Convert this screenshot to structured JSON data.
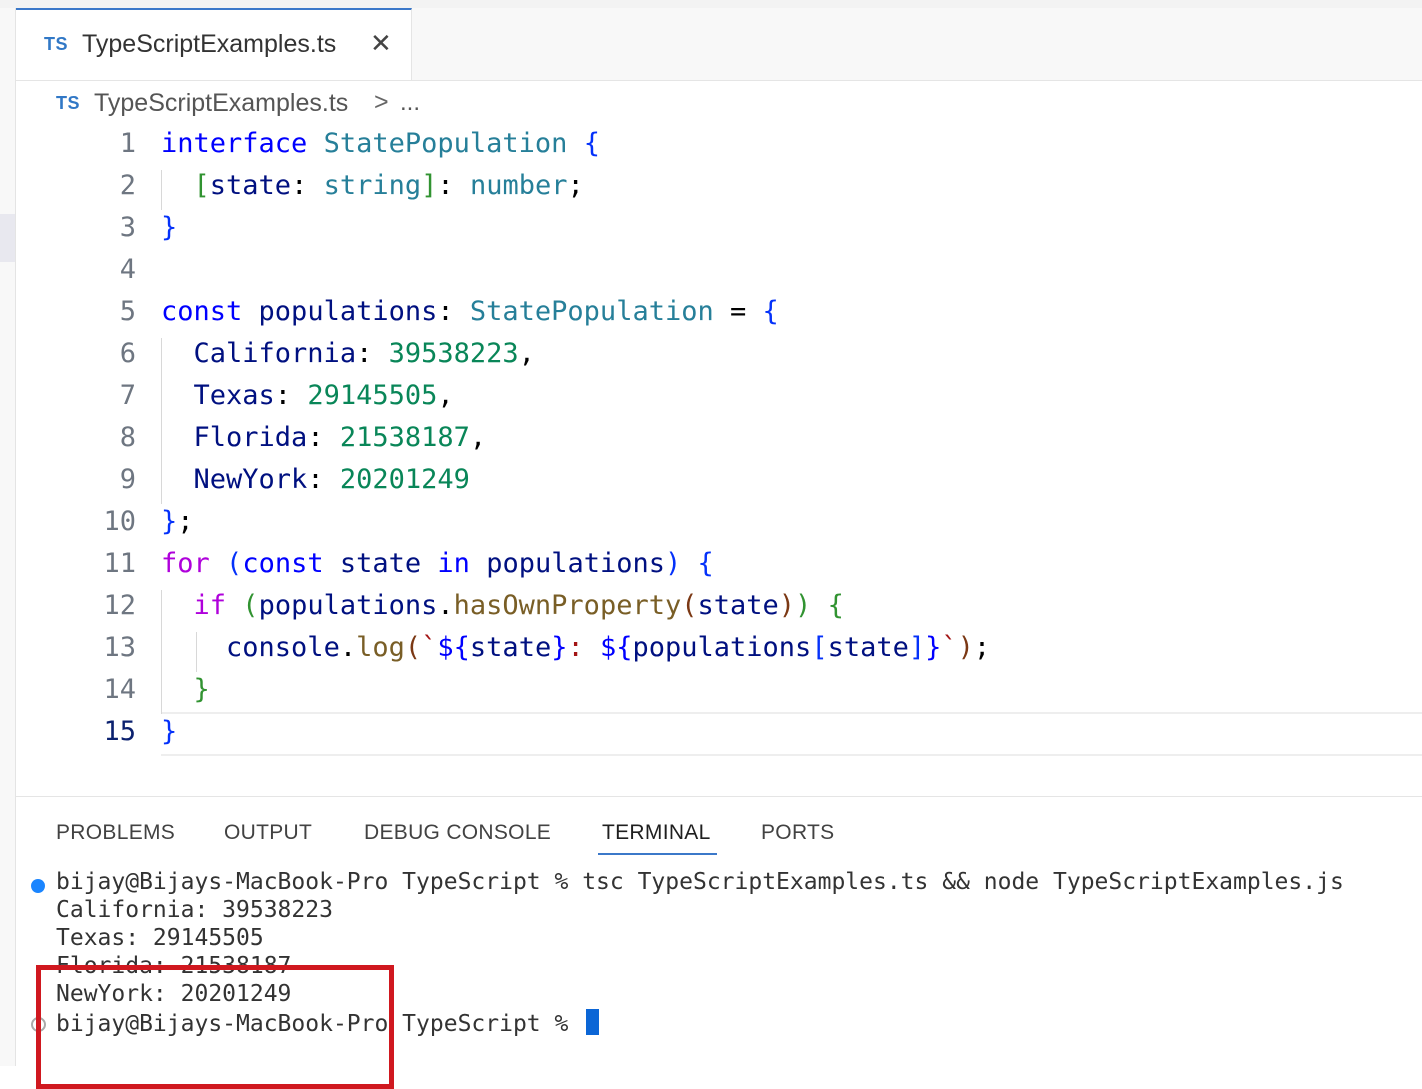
{
  "tab": {
    "badge": "TS",
    "title": "TypeScriptExamples.ts",
    "close": "✕"
  },
  "breadcrumb": {
    "badge": "TS",
    "file": "TypeScriptExamples.ts",
    "separator": ">",
    "more": "..."
  },
  "editor": {
    "lines": [
      {
        "n": "1"
      },
      {
        "n": "2"
      },
      {
        "n": "3"
      },
      {
        "n": "4"
      },
      {
        "n": "5"
      },
      {
        "n": "6"
      },
      {
        "n": "7"
      },
      {
        "n": "8"
      },
      {
        "n": "9"
      },
      {
        "n": "10"
      },
      {
        "n": "11"
      },
      {
        "n": "12"
      },
      {
        "n": "13"
      },
      {
        "n": "14"
      },
      {
        "n": "15"
      }
    ],
    "active_line": "15",
    "tokens": {
      "l1": [
        "interface",
        " ",
        "StatePopulation",
        " ",
        "{"
      ],
      "l2": [
        "  ",
        "[",
        "state",
        ":",
        " ",
        "string",
        "]",
        ":",
        " ",
        "number",
        ";"
      ],
      "l3": [
        "}"
      ],
      "l5": [
        "const",
        " ",
        "populations",
        ":",
        " ",
        "StatePopulation",
        " = ",
        "{"
      ],
      "l6": [
        "  ",
        "California",
        ":",
        " ",
        "39538223",
        ","
      ],
      "l7": [
        "  ",
        "Texas",
        ":",
        " ",
        "29145505",
        ","
      ],
      "l8": [
        "  ",
        "Florida",
        ":",
        " ",
        "21538187",
        ","
      ],
      "l9": [
        "  ",
        "NewYork",
        ":",
        " ",
        "20201249"
      ],
      "l10": [
        "}",
        ";"
      ],
      "l11": [
        "for",
        " ",
        "(",
        "const",
        " ",
        "state",
        " ",
        "in",
        " ",
        "populations",
        ")",
        " ",
        "{"
      ],
      "l12": [
        "  ",
        "if",
        " ",
        "(",
        "populations",
        ".",
        "hasOwnProperty",
        "(",
        "state",
        ")",
        ")",
        " ",
        "{"
      ],
      "l13": [
        "    ",
        "console",
        ".",
        "log",
        "(",
        "`",
        "${",
        "state",
        "}",
        ": ",
        "${",
        "populations",
        "[",
        "state",
        "]",
        "}",
        "`",
        ")",
        ";"
      ],
      "l14": [
        "  ",
        "}"
      ],
      "l15": [
        "}"
      ]
    }
  },
  "panel": {
    "tabs": [
      "PROBLEMS",
      "OUTPUT",
      "DEBUG CONSOLE",
      "TERMINAL",
      "PORTS"
    ],
    "active_tab": "TERMINAL"
  },
  "terminal": {
    "command_line": "bijay@Bijays-MacBook-Pro TypeScript % tsc TypeScriptExamples.ts && node TypeScriptExamples.js",
    "output": [
      "California: 39538223",
      "Texas: 29145505",
      "Florida: 21538187",
      "NewYork: 20201249"
    ],
    "prompt": "bijay@Bijays-MacBook-Pro TypeScript % "
  },
  "colors": {
    "accent": "#3b78c9",
    "ts_badge": "#3178c6",
    "keyword": "#0000ff",
    "control": "#af00db",
    "type": "#267f99",
    "variable": "#001080",
    "number": "#098658",
    "function": "#795e26",
    "string": "#a31515",
    "highlight_box": "#d0181f",
    "cursor": "#0b66d6"
  }
}
